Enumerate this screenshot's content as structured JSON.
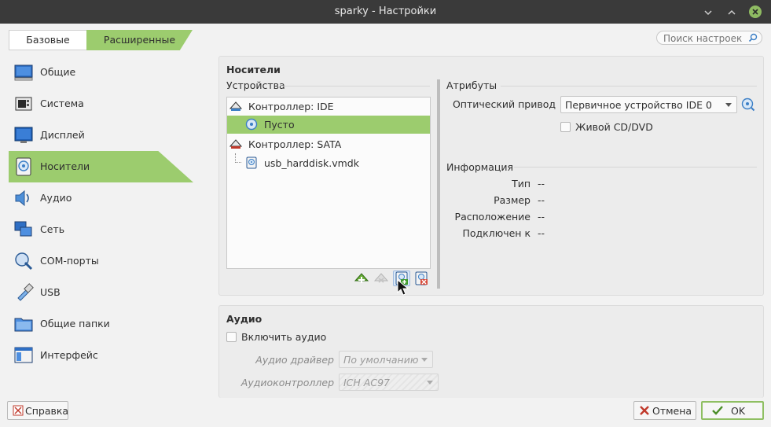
{
  "window": {
    "title": "sparky - Настройки"
  },
  "mode_tabs": {
    "basic": "Базовые",
    "advanced": "Расширенные"
  },
  "search": {
    "placeholder": "Поиск настроек"
  },
  "sidebar": {
    "items": [
      {
        "label": "Общие",
        "icon": "general-icon"
      },
      {
        "label": "Система",
        "icon": "system-icon"
      },
      {
        "label": "Дисплей",
        "icon": "display-icon"
      },
      {
        "label": "Носители",
        "icon": "storage-icon",
        "active": true
      },
      {
        "label": "Аудио",
        "icon": "audio-icon"
      },
      {
        "label": "Сеть",
        "icon": "network-icon"
      },
      {
        "label": "COM-порты",
        "icon": "serial-ports-icon"
      },
      {
        "label": "USB",
        "icon": "usb-icon"
      },
      {
        "label": "Общие папки",
        "icon": "shared-folders-icon"
      },
      {
        "label": "Интерфейс",
        "icon": "user-interface-icon"
      }
    ]
  },
  "storage": {
    "title": "Носители",
    "devices_label": "Устройства",
    "tree": [
      {
        "label": "Контроллер: IDE",
        "kind": "controller"
      },
      {
        "label": "Пусто",
        "kind": "optical",
        "selected": true
      },
      {
        "label": "Контроллер: SATA",
        "kind": "controller"
      },
      {
        "label": "usb_harddisk.vmdk",
        "kind": "disk"
      }
    ],
    "attributes": {
      "label": "Атрибуты",
      "optical_drive_label": "Оптический привод",
      "optical_drive_value": "Первичное устройство IDE 0",
      "live_cd_label": "Живой CD/DVD",
      "live_cd_checked": false
    },
    "info": {
      "label": "Информация",
      "rows": [
        {
          "key": "Тип",
          "value": "--"
        },
        {
          "key": "Размер",
          "value": "--"
        },
        {
          "key": "Расположение",
          "value": "--"
        },
        {
          "key": "Подключен к",
          "value": "--"
        }
      ]
    }
  },
  "audio": {
    "title": "Аудио",
    "enable_label": "Включить аудио",
    "enable_checked": false,
    "driver_label": "Аудио драйвер",
    "driver_value": "По умолчанию",
    "controller_label": "Аудиоконтроллер",
    "controller_value": "ICH AC97"
  },
  "footer": {
    "help": "Справка",
    "cancel": "Отмена",
    "ok": "OK"
  },
  "colors": {
    "accent": "#9ccc6e",
    "titlebar": "#3a3a3a"
  }
}
